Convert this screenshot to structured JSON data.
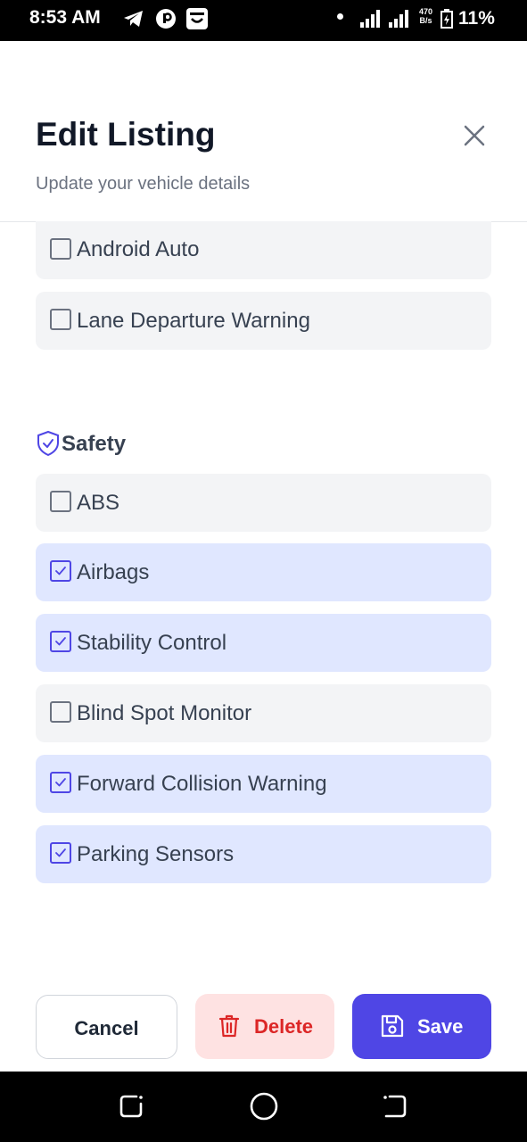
{
  "status_bar": {
    "time": "8:53 AM",
    "net_speed_value": "470",
    "net_speed_unit": "B/s",
    "battery": "11%"
  },
  "header": {
    "title": "Edit Listing",
    "subtitle": "Update your vehicle details"
  },
  "features": {
    "partial_items": [
      {
        "label": "Android Auto",
        "checked": false
      },
      {
        "label": "Lane Departure Warning",
        "checked": false
      }
    ],
    "safety": {
      "title": "Safety",
      "icon": "shield-icon",
      "items": [
        {
          "label": "ABS",
          "checked": false
        },
        {
          "label": "Airbags",
          "checked": true
        },
        {
          "label": "Stability Control",
          "checked": true
        },
        {
          "label": "Blind Spot Monitor",
          "checked": false
        },
        {
          "label": "Forward Collision Warning",
          "checked": true
        },
        {
          "label": "Parking Sensors",
          "checked": true
        }
      ]
    }
  },
  "actions": {
    "cancel": "Cancel",
    "delete": "Delete",
    "save": "Save"
  },
  "colors": {
    "accent": "#4f46e5",
    "checked_bg": "#e0e7ff",
    "unchecked_bg": "#f3f4f6",
    "danger": "#dc2626",
    "danger_bg": "#fee2e2"
  }
}
